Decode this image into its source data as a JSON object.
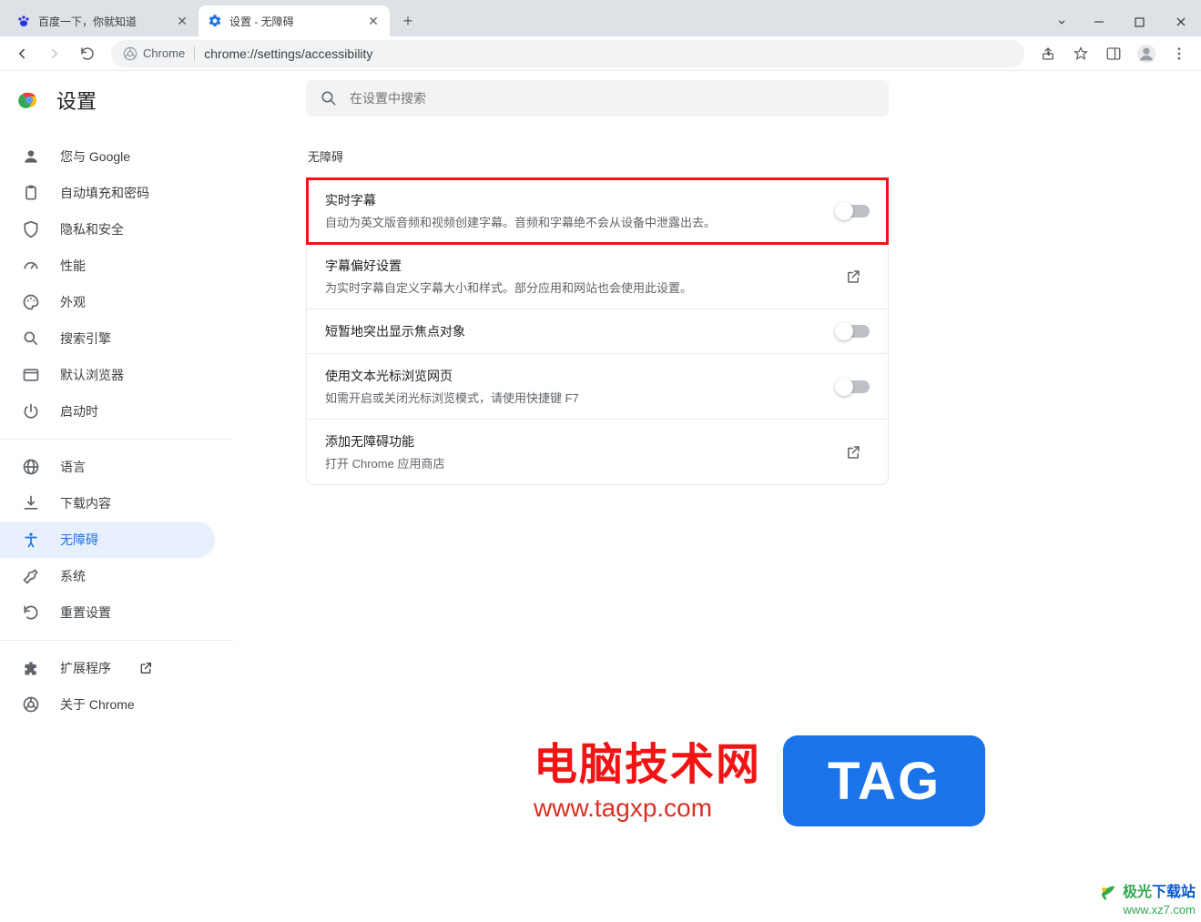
{
  "tabs": [
    {
      "title": "百度一下，你就知道"
    },
    {
      "title": "设置 - 无障碍"
    }
  ],
  "omnibox": {
    "chip": "Chrome",
    "url": "chrome://settings/accessibility"
  },
  "settings": {
    "app_title": "设置",
    "search_placeholder": "在设置中搜索"
  },
  "sidebar": {
    "items": [
      {
        "label": "您与 Google"
      },
      {
        "label": "自动填充和密码"
      },
      {
        "label": "隐私和安全"
      },
      {
        "label": "性能"
      },
      {
        "label": "外观"
      },
      {
        "label": "搜索引擎"
      },
      {
        "label": "默认浏览器"
      },
      {
        "label": "启动时"
      }
    ],
    "items2": [
      {
        "label": "语言"
      },
      {
        "label": "下载内容"
      },
      {
        "label": "无障碍"
      },
      {
        "label": "系统"
      },
      {
        "label": "重置设置"
      }
    ],
    "items3": [
      {
        "label": "扩展程序"
      },
      {
        "label": "关于 Chrome"
      }
    ]
  },
  "section": {
    "title": "无障碍",
    "rows": [
      {
        "primary": "实时字幕",
        "secondary": "自动为英文版音频和视频创建字幕。音频和字幕绝不会从设备中泄露出去。",
        "action": "toggle",
        "highlighted": true
      },
      {
        "primary": "字幕偏好设置",
        "secondary": "为实时字幕自定义字幕大小和样式。部分应用和网站也会使用此设置。",
        "action": "external"
      },
      {
        "primary": "短暂地突出显示焦点对象",
        "secondary": "",
        "action": "toggle"
      },
      {
        "primary": "使用文本光标浏览网页",
        "secondary": "如需开启或关闭光标浏览模式，请使用快捷键 F7",
        "action": "toggle"
      },
      {
        "primary": "添加无障碍功能",
        "secondary": "打开 Chrome 应用商店",
        "action": "external"
      }
    ]
  },
  "watermark": {
    "cn": "电脑技术网",
    "url": "www.tagxp.com",
    "tag": "TAG",
    "corner_a_prefix": "极光",
    "corner_a_suffix": "下载站",
    "corner_b": "www.xz7.com"
  }
}
